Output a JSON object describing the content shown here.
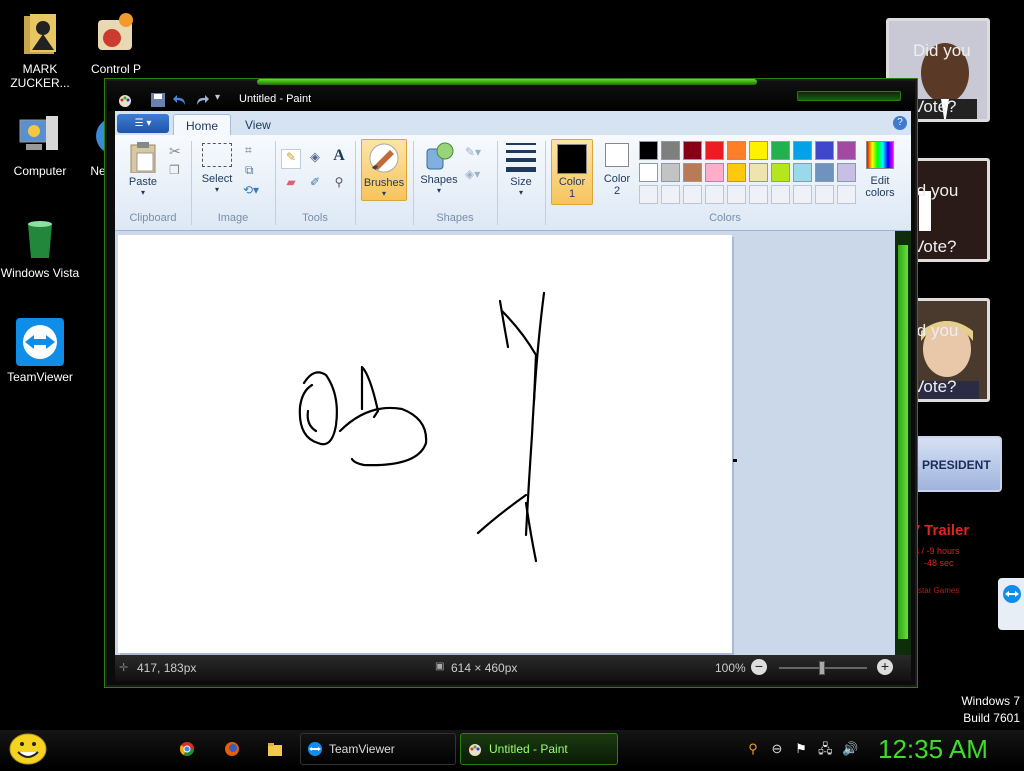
{
  "desktop": {
    "icons": [
      {
        "label": "MARK ZUCKER...",
        "icon": "folder-person-icon"
      },
      {
        "label": "Control P",
        "icon": "control-panel-icon"
      },
      {
        "label": "Computer",
        "icon": "computer-icon"
      },
      {
        "label": "Ne",
        "icon": "network-icon"
      },
      {
        "label": "Windows Vista",
        "icon": "recycle-bin-icon"
      },
      {
        "label": "TeamViewer",
        "icon": "teamviewer-icon"
      }
    ],
    "gadgets": [
      {
        "line1": "Did you",
        "line2": "Vote?"
      },
      {
        "line1": "id you",
        "line2": "Vote?"
      },
      {
        "line1": "id you",
        "line2": "Vote?"
      }
    ],
    "banner": "R PRESIDENT",
    "trailer": {
      "title": "V Trailer",
      "line1": "ys / -9 hours",
      "line2": "-48 sec",
      "line3": "ckstar Games"
    },
    "watermark": {
      "os": "Windows 7",
      "build": "Build 7601"
    }
  },
  "window": {
    "title": "Untitled - Paint",
    "tabs": [
      "Home",
      "View"
    ],
    "groups": {
      "clipboard": {
        "label": "Clipboard",
        "paste": "Paste"
      },
      "image": {
        "label": "Image",
        "select": "Select"
      },
      "tools": {
        "label": "Tools"
      },
      "brushes": {
        "label": "Brushes"
      },
      "shapes": {
        "label": "Shapes",
        "shapes": "Shapes"
      },
      "size": {
        "label": "Size"
      },
      "color1": {
        "label": "Color",
        "num": "1"
      },
      "color2": {
        "label": "Color",
        "num": "2"
      },
      "colors": {
        "label": "Colors",
        "edit": "Edit",
        "edit2": "colors"
      }
    },
    "palette_row1": [
      "#000000",
      "#7f7f7f",
      "#880015",
      "#ed1c24",
      "#ff7f27",
      "#fff200",
      "#22b14c",
      "#00a2e8",
      "#3f48cc",
      "#a349a4"
    ],
    "palette_row2": [
      "#ffffff",
      "#c3c3c3",
      "#b97a57",
      "#ffaec9",
      "#ffc90e",
      "#efe4b0",
      "#b5e61d",
      "#99d9ea",
      "#7092be",
      "#c8bfe7"
    ],
    "status": {
      "cursor": "417, 183px",
      "canvas_size": "614 × 460px",
      "zoom": "100%"
    }
  },
  "taskbar": {
    "items": [
      {
        "label": "TeamViewer"
      },
      {
        "label": "Untitled - Paint"
      }
    ],
    "clock": "12:35 AM"
  }
}
